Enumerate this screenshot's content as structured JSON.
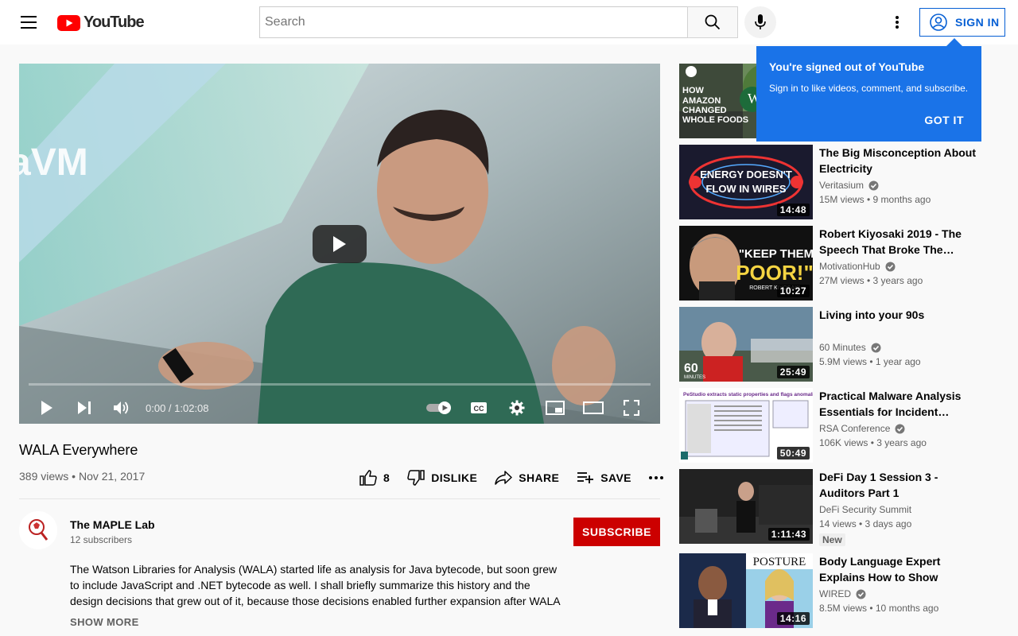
{
  "header": {
    "logo_text": "YouTube",
    "search_placeholder": "Search",
    "signin_label": "SIGN IN"
  },
  "player": {
    "time": "0:00 / 1:02:08",
    "slide_text": "aVM",
    "progress_fraction": 0
  },
  "video": {
    "title": "WALA Everywhere",
    "views": "389 views",
    "date": "Nov 21, 2017",
    "likes": "8",
    "dislike_label": "DISLIKE",
    "share_label": "SHARE",
    "save_label": "SAVE"
  },
  "channel": {
    "name": "The MAPLE Lab",
    "subscribers": "12 subscribers",
    "subscribe_label": "SUBSCRIBE",
    "description": "The Watson Libraries for Analysis (WALA) started life as analysis for Java bytecode, but soon grew to include JavaScript and .NET bytecode as well. I shall briefly summarize this history and the design decisions that grew out of it, because those decisions enabled further expansion after WALA",
    "show_more": "SHOW MORE"
  },
  "tooltip": {
    "title": "You're signed out of YouTube",
    "body": "Sign in to like videos, comment, and subscribe.",
    "button": "GOT IT"
  },
  "recommendations": [
    {
      "title": "",
      "channel": "",
      "views": "",
      "duration": "",
      "thumb_text": "HOW AMAZON CHANGED WHOLE FOODS"
    },
    {
      "title": "The Big Misconception About Electricity",
      "channel": "Veritasium",
      "views": "15M views • 9 months ago",
      "duration": "14:48",
      "thumb_text": "ENERGY DOESN'T FLOW IN WIRES"
    },
    {
      "title": "Robert Kiyosaki 2019 - The Speech That Broke The…",
      "channel": "MotivationHub",
      "views": "27M views • 3 years ago",
      "duration": "10:27",
      "thumb_text": "\"KEEP THEM POOR!\"",
      "thumb_sub": "ROBERT KIYOSAKI"
    },
    {
      "title": "Living into your 90s",
      "channel": "60 Minutes",
      "views": "5.9M views • 1 year ago",
      "duration": "25:49",
      "thumb_text": "60 MINUTES"
    },
    {
      "title": "Practical Malware Analysis Essentials for Incident…",
      "channel": "RSA Conference",
      "views": "106K views • 3 years ago",
      "duration": "50:49",
      "thumb_text": "PeStudio extracts static properties and flags anomalies."
    },
    {
      "title": "DeFi Day 1 Session 3 - Auditors Part 1",
      "channel": "DeFi Security Summit",
      "views": "14 views • 3 days ago",
      "duration": "1:11:43",
      "badge": "New"
    },
    {
      "title": "Body Language Expert Explains How to Show Confidence |…",
      "channel": "WIRED",
      "views": "8.5M views • 10 months ago",
      "duration": "14:16",
      "thumb_text": "POSTURE"
    }
  ],
  "colors": {
    "brand_red": "#ff0000",
    "link_blue": "#065fd4",
    "tooltip_blue": "#1a73e8",
    "subscribe_red": "#cc0000"
  }
}
